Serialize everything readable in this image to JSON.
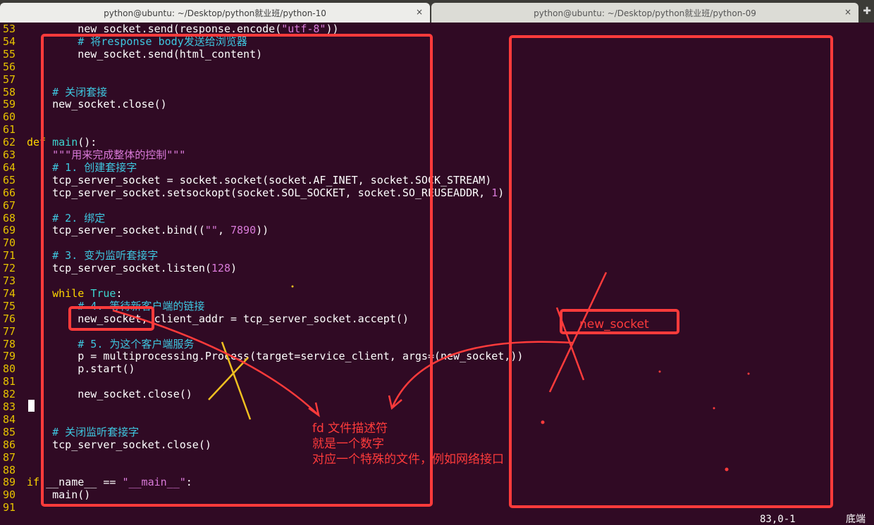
{
  "tabs": [
    {
      "label": "python@ubuntu: ~/Desktop/python就业班/python-10",
      "close": "×"
    },
    {
      "label": "python@ubuntu: ~/Desktop/python就业班/python-09",
      "close": "×"
    }
  ],
  "new_tab_icon": "plus-icon",
  "code_lines": [
    {
      "n": "53",
      "seg": [
        [
          "txt",
          "        new_socket.send(response.encode("
        ],
        [
          "str",
          "\"utf-8\""
        ],
        [
          "txt",
          "))"
        ]
      ]
    },
    {
      "n": "54",
      "seg": [
        [
          "cm",
          "        # 将response body发送给浏览器"
        ]
      ]
    },
    {
      "n": "55",
      "seg": [
        [
          "txt",
          "        new_socket.send(html_content)"
        ]
      ]
    },
    {
      "n": "56",
      "seg": []
    },
    {
      "n": "57",
      "seg": []
    },
    {
      "n": "58",
      "seg": [
        [
          "cm",
          "    # 关闭套接"
        ]
      ]
    },
    {
      "n": "59",
      "seg": [
        [
          "txt",
          "    new_socket.close()"
        ]
      ]
    },
    {
      "n": "60",
      "seg": []
    },
    {
      "n": "61",
      "seg": []
    },
    {
      "n": "62",
      "seg": [
        [
          "kw",
          "def "
        ],
        [
          "fn",
          "main"
        ],
        [
          "txt",
          "():"
        ]
      ]
    },
    {
      "n": "63",
      "seg": [
        [
          "str",
          "    \"\"\"用来完成整体的控制\"\"\""
        ]
      ]
    },
    {
      "n": "64",
      "seg": [
        [
          "cm",
          "    # 1. 创建套接字"
        ]
      ]
    },
    {
      "n": "65",
      "seg": [
        [
          "txt",
          "    tcp_server_socket = socket.socket(socket.AF_INET, socket.SOCK_STREAM)"
        ]
      ]
    },
    {
      "n": "66",
      "seg": [
        [
          "txt",
          "    tcp_server_socket.setsockopt(socket.SOL_SOCKET, socket.SO_REUSEADDR, "
        ],
        [
          "num",
          "1"
        ],
        [
          "txt",
          ")"
        ]
      ]
    },
    {
      "n": "67",
      "seg": []
    },
    {
      "n": "68",
      "seg": [
        [
          "cm",
          "    # 2. 绑定"
        ]
      ]
    },
    {
      "n": "69",
      "seg": [
        [
          "txt",
          "    tcp_server_socket.bind(("
        ],
        [
          "str",
          "\"\""
        ],
        [
          "txt",
          ", "
        ],
        [
          "num",
          "7890"
        ],
        [
          "txt",
          "))"
        ]
      ]
    },
    {
      "n": "70",
      "seg": []
    },
    {
      "n": "71",
      "seg": [
        [
          "cm",
          "    # 3. 变为监听套接字"
        ]
      ]
    },
    {
      "n": "72",
      "seg": [
        [
          "txt",
          "    tcp_server_socket.listen("
        ],
        [
          "num",
          "128"
        ],
        [
          "txt",
          ")"
        ]
      ]
    },
    {
      "n": "73",
      "seg": []
    },
    {
      "n": "74",
      "seg": [
        [
          "kw",
          "    while "
        ],
        [
          "fn",
          "True"
        ],
        [
          "txt",
          ":"
        ]
      ]
    },
    {
      "n": "75",
      "seg": [
        [
          "cm",
          "        # 4. 等待新客户端的链接"
        ]
      ]
    },
    {
      "n": "76",
      "seg": [
        [
          "txt",
          "        new_socket, client_addr = tcp_server_socket.accept()"
        ]
      ]
    },
    {
      "n": "77",
      "seg": []
    },
    {
      "n": "78",
      "seg": [
        [
          "cm",
          "        # 5. 为这个客户端服务"
        ]
      ]
    },
    {
      "n": "79",
      "seg": [
        [
          "txt",
          "        p = multiprocessing.Process(target=service_client, args=(new_socket,))"
        ]
      ]
    },
    {
      "n": "80",
      "seg": [
        [
          "txt",
          "        p.start()"
        ]
      ]
    },
    {
      "n": "81",
      "seg": []
    },
    {
      "n": "82",
      "seg": [
        [
          "txt",
          "        new_socket.close()"
        ]
      ]
    },
    {
      "n": "83",
      "seg": []
    },
    {
      "n": "84",
      "seg": []
    },
    {
      "n": "85",
      "seg": [
        [
          "cm",
          "    # 关闭监听套接字"
        ]
      ]
    },
    {
      "n": "86",
      "seg": [
        [
          "txt",
          "    tcp_server_socket.close()"
        ]
      ]
    },
    {
      "n": "87",
      "seg": []
    },
    {
      "n": "88",
      "seg": []
    },
    {
      "n": "89",
      "seg": [
        [
          "kw",
          "if "
        ],
        [
          "txt",
          "__name__ == "
        ],
        [
          "str",
          "\"__main__\""
        ],
        [
          "txt",
          ":"
        ]
      ]
    },
    {
      "n": "90",
      "seg": [
        [
          "txt",
          "    main()"
        ]
      ]
    },
    {
      "n": "91",
      "seg": []
    }
  ],
  "annotations": {
    "new_socket_label": "new_socket",
    "note_lines": [
      "fd 文件描述符",
      "就是一个数字",
      "对应一个特殊的文件，例如网络接口"
    ],
    "color": "#ff3b3b",
    "x_mark_color": "#f0c020"
  },
  "status": {
    "position": "83,0-1",
    "scroll": "底端"
  }
}
